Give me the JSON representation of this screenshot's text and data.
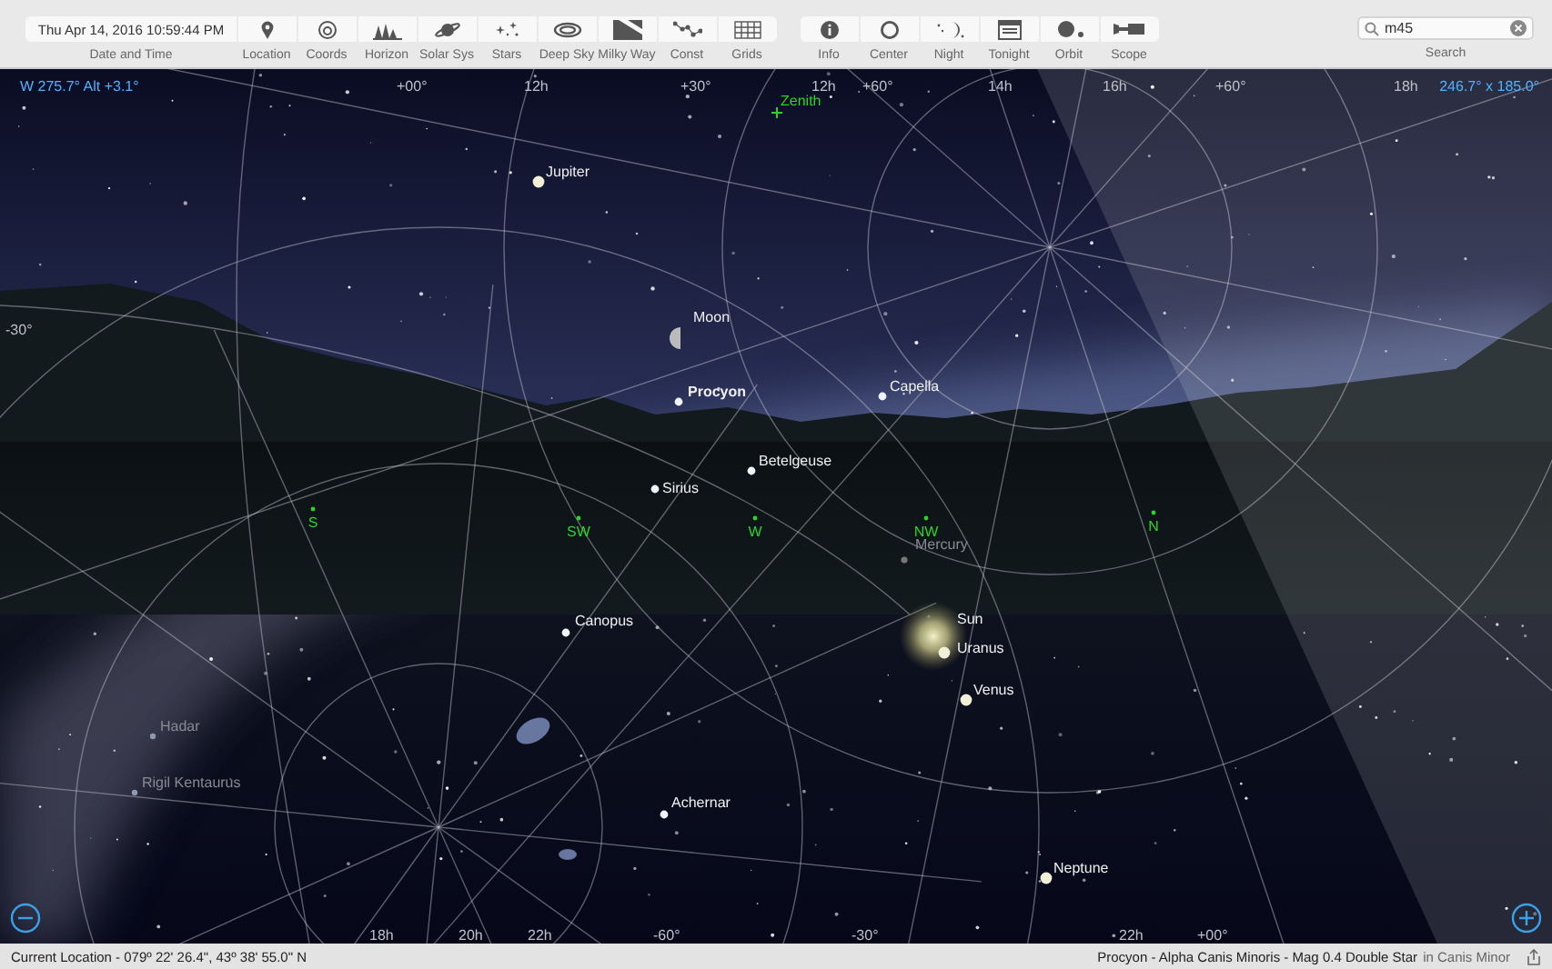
{
  "toolbar": {
    "date_time": {
      "value": "Thu Apr 14, 2016 10:59:44 PM",
      "label": "Date and Time"
    },
    "view_tools": [
      {
        "kind": "location",
        "label": "Location"
      },
      {
        "kind": "coords",
        "label": "Coords"
      },
      {
        "kind": "horizon",
        "label": "Horizon"
      },
      {
        "kind": "solar",
        "label": "Solar Sys"
      },
      {
        "kind": "stars",
        "label": "Stars"
      },
      {
        "kind": "deepsky",
        "label": "Deep Sky"
      },
      {
        "kind": "milkyway",
        "label": "Milky Way"
      },
      {
        "kind": "const",
        "label": "Const"
      },
      {
        "kind": "grids",
        "label": "Grids"
      }
    ],
    "info_tools": [
      {
        "kind": "info",
        "label": "Info"
      },
      {
        "kind": "center",
        "label": "Center"
      },
      {
        "kind": "night",
        "label": "Night"
      },
      {
        "kind": "tonight",
        "label": "Tonight"
      },
      {
        "kind": "orbit",
        "label": "Orbit"
      },
      {
        "kind": "scope",
        "label": "Scope"
      }
    ],
    "search": {
      "value": "m45",
      "label": "Search"
    }
  },
  "sky": {
    "view_direction": "W 275.7° Alt +3.1°",
    "field_of_view": "246.7° x 185.0°",
    "zenith": "Zenith",
    "grid_labels": [
      "+00°",
      "12h",
      "+30°",
      "12h",
      "+60°",
      "14h",
      "16h",
      "+60°",
      "18h",
      "-30°",
      "18h",
      "20h",
      "22h",
      "-60°",
      "-30°",
      "22h",
      "+00°"
    ],
    "objects": [
      {
        "name": "Jupiter",
        "kind": "planet",
        "selected": false,
        "dimmed": false
      },
      {
        "name": "Moon",
        "kind": "moon",
        "selected": false,
        "dimmed": false
      },
      {
        "name": "Procyon",
        "kind": "star",
        "selected": true,
        "dimmed": false
      },
      {
        "name": "Capella",
        "kind": "star",
        "selected": false,
        "dimmed": false
      },
      {
        "name": "Betelgeuse",
        "kind": "star",
        "selected": false,
        "dimmed": false
      },
      {
        "name": "Sirius",
        "kind": "star",
        "selected": false,
        "dimmed": false
      },
      {
        "name": "Mercury",
        "kind": "planet",
        "selected": false,
        "dimmed": true
      },
      {
        "name": "Sun",
        "kind": "sun",
        "selected": false,
        "dimmed": false
      },
      {
        "name": "Uranus",
        "kind": "planet",
        "selected": false,
        "dimmed": false
      },
      {
        "name": "Venus",
        "kind": "planet",
        "selected": false,
        "dimmed": false
      },
      {
        "name": "Canopus",
        "kind": "star",
        "selected": false,
        "dimmed": false
      },
      {
        "name": "Hadar",
        "kind": "star",
        "selected": false,
        "dimmed": true
      },
      {
        "name": "Rigil Kentaurus",
        "kind": "star",
        "selected": false,
        "dimmed": true
      },
      {
        "name": "Achernar",
        "kind": "star",
        "selected": false,
        "dimmed": false
      },
      {
        "name": "Neptune",
        "kind": "planet",
        "selected": false,
        "dimmed": false
      }
    ],
    "compass_points": [
      "S",
      "SW",
      "W",
      "NW",
      "N"
    ]
  },
  "status_bar": {
    "location": "Current Location - 079º 22' 26.4\", 43º 38' 55.0\" N",
    "selection": "Procyon - Alpha Canis Minoris - Mag 0.4 Double Star",
    "selection_context": "in Canis Minor"
  }
}
